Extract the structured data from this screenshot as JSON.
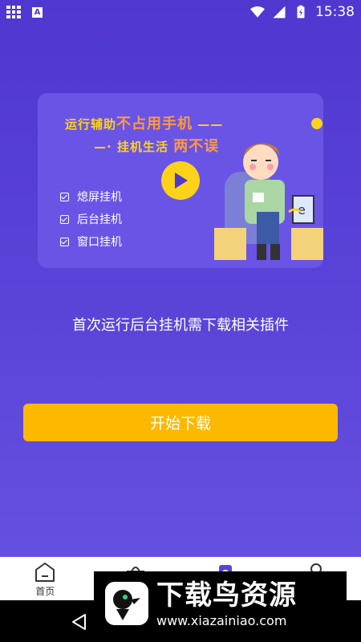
{
  "status_bar": {
    "time": "15:38",
    "icons": [
      "apps-grid-icon",
      "a-notification-icon",
      "wifi-icon",
      "signal-icon",
      "battery-icon"
    ]
  },
  "banner": {
    "slogan_line1_prefix": "运行辅助",
    "slogan_line1_highlight": "不占用手机",
    "slogan_line1_dash": "——",
    "slogan_line2_dash": "—·",
    "slogan_line2_prefix": "挂机生活",
    "slogan_line2_highlight": "两不误",
    "features": [
      "熄屏挂机",
      "后台挂机",
      "窗口挂机"
    ]
  },
  "notice": "首次运行后台挂机需下载相关插件",
  "download_button": "开始下载",
  "bottom_nav": {
    "home_label": "首页"
  },
  "watermark": {
    "title": "下载鸟资源",
    "url": "www.xiazainiao.com"
  },
  "colors": {
    "background": "#5a44d8",
    "button": "#fdb800",
    "accent_yellow": "#ffd21a"
  }
}
